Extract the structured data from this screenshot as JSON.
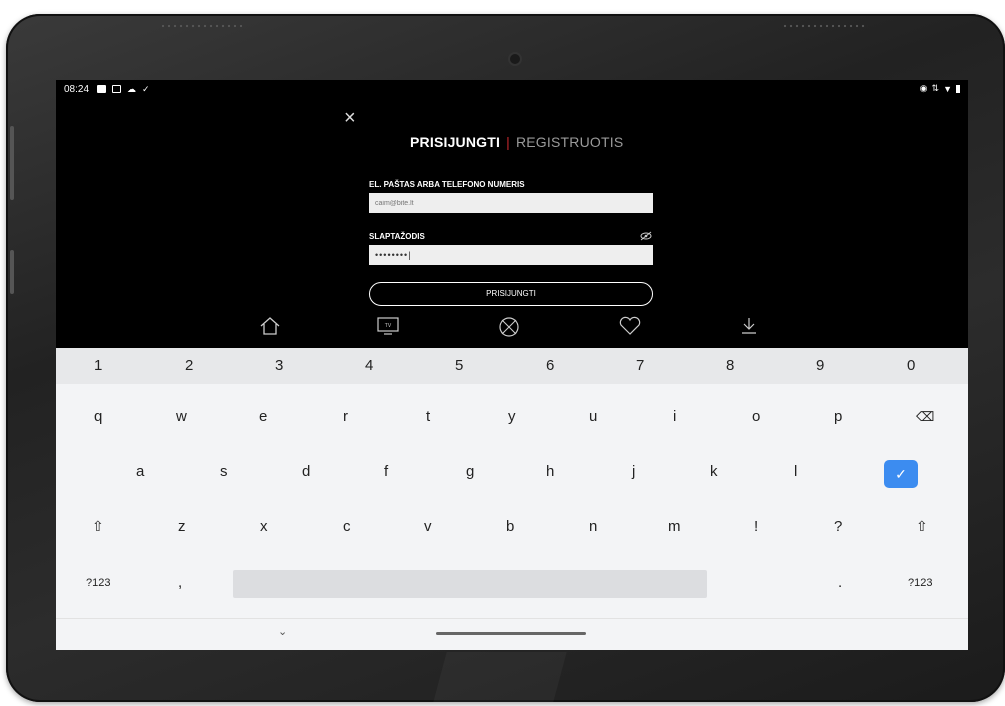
{
  "status_bar": {
    "time": "08:24",
    "left_icons": [
      "image-icon",
      "gallery-icon",
      "cloud-icon",
      "check-icon"
    ],
    "right_icons": [
      "vibrate-icon",
      "data-icon",
      "wifi-icon",
      "battery-icon"
    ]
  },
  "login": {
    "tab_login": "PRISIJUNGTI",
    "tab_separator": "|",
    "tab_register": "REGISTRUOTIS",
    "email_label": "EL. PAŠTAS ARBA TELEFONO NUMERIS",
    "email_placeholder": "caim@bite.lt",
    "password_label": "SLAPTAŽODIS",
    "password_value": "••••••••|",
    "submit_label": "PRISIJUNGTI",
    "close_glyph": "×"
  },
  "nav": {
    "items": [
      "home-icon",
      "tv-icon",
      "sports-icon",
      "favorites-icon",
      "download-icon"
    ],
    "tv_text": "TV"
  },
  "keyboard": {
    "numbers": [
      "1",
      "2",
      "3",
      "4",
      "5",
      "6",
      "7",
      "8",
      "9",
      "0"
    ],
    "row1": [
      "q",
      "w",
      "e",
      "r",
      "t",
      "y",
      "u",
      "i",
      "o",
      "p"
    ],
    "row2": [
      "a",
      "s",
      "d",
      "f",
      "g",
      "h",
      "j",
      "k",
      "l"
    ],
    "row3": [
      "z",
      "x",
      "c",
      "v",
      "b",
      "n",
      "m",
      "!",
      "?"
    ],
    "symbols_label": "?123",
    "comma": ",",
    "period": ".",
    "shift_glyph": "⇧",
    "backspace_glyph": "⌫",
    "done_glyph": "✓",
    "hide_glyph": "⌄"
  },
  "colors": {
    "accent_red": "#c0272d",
    "done_blue": "#3c8cf0"
  }
}
